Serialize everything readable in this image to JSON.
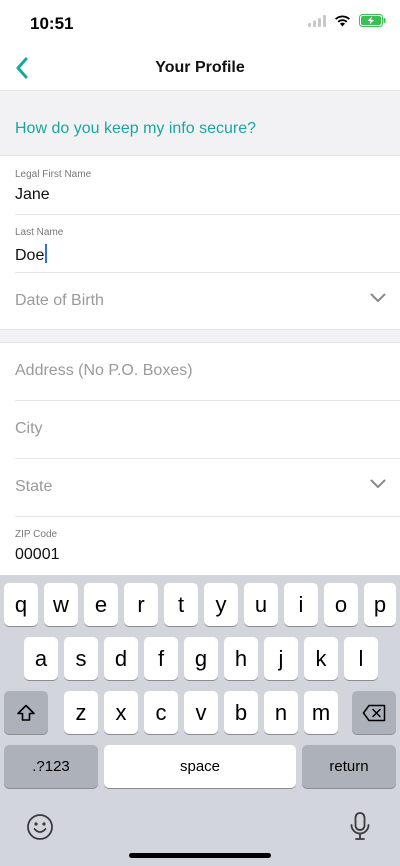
{
  "status": {
    "time": "10:51"
  },
  "nav": {
    "title": "Your Profile"
  },
  "info_link": "How do you keep my info secure?",
  "fields": {
    "first_name": {
      "label": "Legal First Name",
      "value": "Jane"
    },
    "last_name": {
      "label": "Last Name",
      "value": "Doe"
    },
    "dob": {
      "placeholder": "Date of Birth"
    },
    "address": {
      "placeholder": "Address (No P.O. Boxes)"
    },
    "city": {
      "placeholder": "City"
    },
    "state": {
      "placeholder": "State"
    },
    "zip": {
      "label": "ZIP Code",
      "value": "00001"
    }
  },
  "keyboard": {
    "row1": [
      "q",
      "w",
      "e",
      "r",
      "t",
      "y",
      "u",
      "i",
      "o",
      "p"
    ],
    "row2": [
      "a",
      "s",
      "d",
      "f",
      "g",
      "h",
      "j",
      "k",
      "l"
    ],
    "row3": [
      "z",
      "x",
      "c",
      "v",
      "b",
      "n",
      "m"
    ],
    "numbers_label": ".?123",
    "space_label": "space",
    "return_label": "return"
  },
  "colors": {
    "accent": "#1aa6a0",
    "keyboard_bg": "#d3d5dc",
    "caret": "#2f6fe0"
  }
}
